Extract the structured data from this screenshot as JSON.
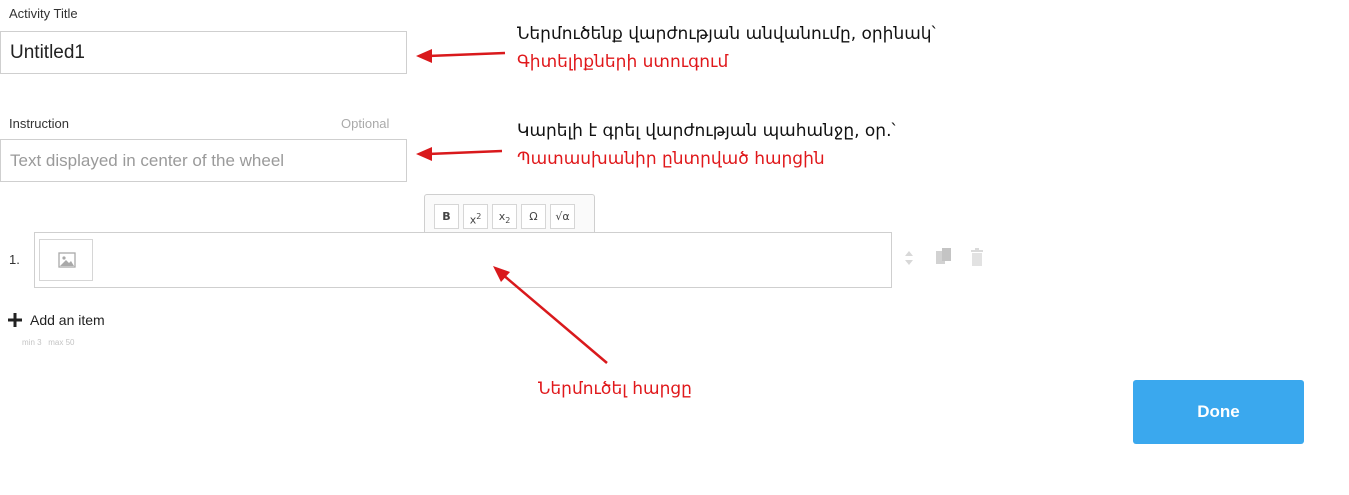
{
  "activity_title": {
    "label": "Activity Title",
    "value": "Untitled1"
  },
  "instruction": {
    "label": "Instruction",
    "optional_label": "Optional",
    "placeholder": "Text displayed in center of the wheel"
  },
  "toolbar": {
    "bold": "B",
    "superscript_base": "x",
    "superscript_exp": "2",
    "subscript_base": "x",
    "subscript_exp": "2",
    "omega": "Ω",
    "sqrt": "√α"
  },
  "items": [
    {
      "number": "1."
    }
  ],
  "add_item": {
    "label": "Add an item",
    "limits": "min 3   max 50"
  },
  "annotations": {
    "title_note": "Ներմուծենք վարժության անվանումը, օրինակ՝",
    "title_example": "Գիտելիքների ստուգում",
    "instruction_note": "Կարելի է գրել վարժության պահանջը, օր.՝",
    "instruction_example": "Պատասխանիր ընտրված հարցին",
    "item_note": "Ներմուծել հարցը"
  },
  "done_button": "Done",
  "colors": {
    "accent": "#3aa8ee",
    "annotation_red": "#e0181b"
  }
}
